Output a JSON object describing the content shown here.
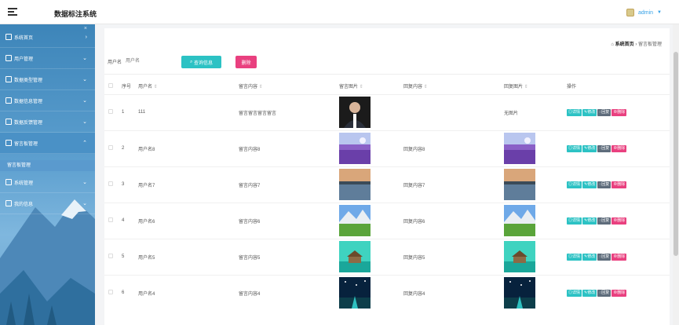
{
  "header": {
    "title": "数据标注系统",
    "user": "admin"
  },
  "sidebar": {
    "items": [
      {
        "label": "系统首页",
        "icon": "home-icon"
      },
      {
        "label": "用户管理",
        "icon": "user-icon"
      },
      {
        "label": "数据类型管理",
        "icon": "tag-icon"
      },
      {
        "label": "数据信息管理",
        "icon": "send-icon"
      },
      {
        "label": "数据反馈管理",
        "icon": "grid-icon"
      },
      {
        "label": "留言板管理",
        "icon": "message-icon"
      },
      {
        "label": "系统管理",
        "icon": "grid-icon"
      },
      {
        "label": "我的信息",
        "icon": "card-icon"
      }
    ],
    "submenu": "留言板管理"
  },
  "breadcrumb": {
    "home": "系统首页",
    "separator": "›",
    "current": "留言板管理"
  },
  "search": {
    "label": "用户名",
    "placeholder": "用户名",
    "search_button": "查询信息",
    "delete_button": "删除"
  },
  "table": {
    "headers": [
      "序号",
      "用户名",
      "留言内容",
      "留言图片",
      "回复内容",
      "回复图片",
      "操作"
    ],
    "rows": [
      {
        "index": "1",
        "user": "111",
        "content": "留言留言留言留言",
        "reply": "",
        "reply_image": "无图片",
        "img": "portrait"
      },
      {
        "index": "2",
        "user": "用户名8",
        "content": "留言内容8",
        "reply": "回复内容8",
        "reply_image": "",
        "img": "lavender"
      },
      {
        "index": "3",
        "user": "用户名7",
        "content": "留言内容7",
        "reply": "回复内容7",
        "reply_image": "",
        "img": "lake"
      },
      {
        "index": "4",
        "user": "用户名6",
        "content": "留言内容6",
        "reply": "回复内容6",
        "reply_image": "",
        "img": "mountain"
      },
      {
        "index": "5",
        "user": "用户名5",
        "content": "留言内容5",
        "reply": "回复内容5",
        "reply_image": "",
        "img": "hut"
      },
      {
        "index": "6",
        "user": "用户名4",
        "content": "留言内容4",
        "reply": "回复内容4",
        "reply_image": "",
        "img": "night"
      }
    ],
    "ops": [
      "详情",
      "修改",
      "回复",
      "删除"
    ]
  }
}
